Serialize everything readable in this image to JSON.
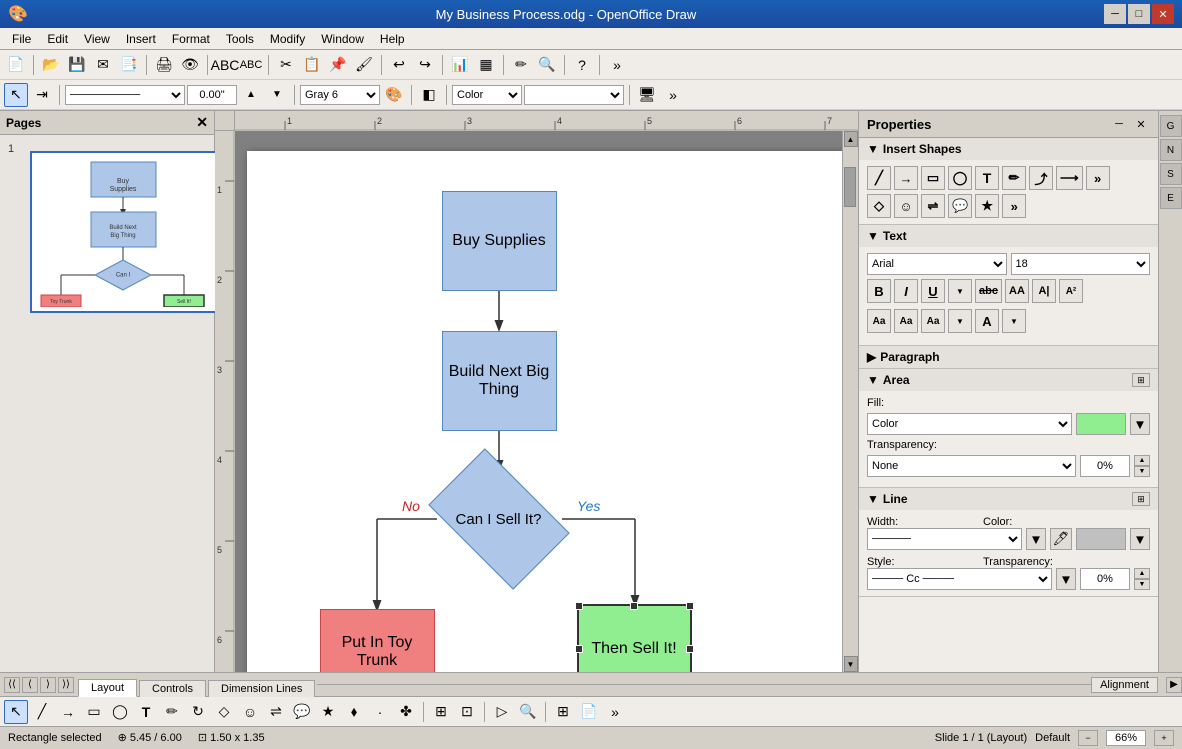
{
  "titleBar": {
    "title": "My Business Process.odg - OpenOffice Draw",
    "appIcon": "🎨",
    "minimizeLabel": "─",
    "maximizeLabel": "□",
    "closeLabel": "✕"
  },
  "menuBar": {
    "items": [
      "File",
      "Edit",
      "View",
      "Insert",
      "Format",
      "Tools",
      "Modify",
      "Window",
      "Help"
    ]
  },
  "pagesPanel": {
    "title": "Pages",
    "page1Label": "1"
  },
  "canvas": {
    "shapes": {
      "buySupplies": {
        "label": "Buy Supplies"
      },
      "buildNextBigThing": {
        "label": "Build Next Big Thing"
      },
      "canISellIt": {
        "label": "Can I Sell It?"
      },
      "putInToyTrunk": {
        "label": "Put In Toy Trunk"
      },
      "thenSellIt": {
        "label": "Then Sell It!"
      },
      "noLabel": "No",
      "yesLabel": "Yes"
    }
  },
  "properties": {
    "title": "Properties",
    "sections": {
      "insertShapes": "Insert Shapes",
      "text": "Text",
      "paragraph": "Paragraph",
      "area": "Area",
      "line": "Line"
    },
    "text": {
      "fontName": "Arial",
      "fontSize": "18"
    },
    "area": {
      "fillLabel": "Fill:",
      "fillType": "Color",
      "transparencyLabel": "Transparency:",
      "transparencyType": "None",
      "transparencyValue": "0%"
    },
    "line": {
      "widthLabel": "Width:",
      "colorLabel": "Color:",
      "styleLabel": "Style:",
      "transparencyLabel": "Transparency:",
      "transparencyValue": "0%"
    }
  },
  "sheetTabs": {
    "tabs": [
      "Layout",
      "Controls",
      "Dimension Lines"
    ],
    "activeTab": "Layout"
  },
  "statusBar": {
    "leftText": "Rectangle selected",
    "positionLabel": "5.45 / 6.00",
    "sizeLabel": "1.50 x 1.35",
    "slideLabel": "Slide 1 / 1 (Layout)",
    "layoutLabel": "Default",
    "zoomLabel": "66%"
  },
  "secondToolbar": {
    "lineStyleLabel": "─────",
    "lineWidthLabel": "0.00\"",
    "colorLabel": "Gray 6",
    "colorMode": "Color"
  }
}
